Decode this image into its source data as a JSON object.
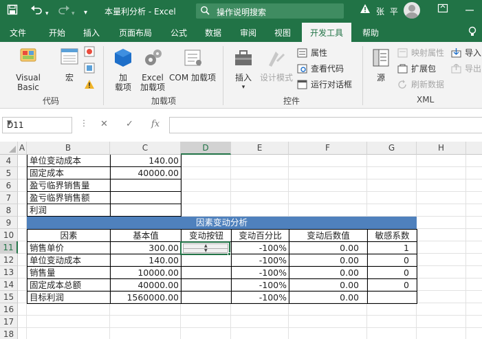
{
  "titlebar": {
    "title": "本量利分析  -  Excel",
    "search_placeholder": "操作说明搜索",
    "user_name": "张 平"
  },
  "tabs": [
    "文件",
    "开始",
    "插入",
    "页面布局",
    "公式",
    "数据",
    "审阅",
    "视图",
    "开发工具",
    "帮助"
  ],
  "active_tab": "开发工具",
  "ribbon": {
    "code_group": {
      "label": "代码",
      "visual_basic": "Visual Basic",
      "macros": "宏"
    },
    "addins_group": {
      "label": "加载项",
      "addins_1": "加",
      "addins_2": "载项",
      "excel_addins_1": "Excel",
      "excel_addins_2": "加载项",
      "com_addins": "COM 加载项"
    },
    "controls_group": {
      "label": "控件",
      "insert": "插入",
      "design_mode": "设计模式",
      "properties": "属性",
      "view_code": "查看代码",
      "run_dialog": "运行对话框"
    },
    "xml_group": {
      "label": "XML",
      "source": "源",
      "map_properties": "映射属性",
      "expansion_packs": "扩展包",
      "refresh_data": "刷新数据",
      "import": "导入",
      "export": "导出"
    }
  },
  "formula_bar": {
    "name_box": "D11",
    "fx": "fx",
    "formula": ""
  },
  "columns": [
    "A",
    "B",
    "C",
    "D",
    "E",
    "F",
    "G",
    "H"
  ],
  "selected_column": "D",
  "rows": [
    "4",
    "5",
    "6",
    "7",
    "8",
    "9",
    "10",
    "11",
    "12",
    "13",
    "14",
    "15",
    "16",
    "17",
    "18"
  ],
  "selected_row": "11",
  "sheet": {
    "top_table": [
      {
        "label": "单位变动成本",
        "value": "140.00"
      },
      {
        "label": "固定成本",
        "value": "40000.00"
      },
      {
        "label": "盈亏临界销售量",
        "value": ""
      },
      {
        "label": "盈亏临界销售额",
        "value": ""
      },
      {
        "label": "利润",
        "value": ""
      }
    ],
    "banner": "因素变动分析",
    "headers": [
      "因素",
      "基本值",
      "变动按钮",
      "变动百分比",
      "变动后数值",
      "敏感系数"
    ],
    "data_rows": [
      {
        "factor": "销售单价",
        "base": "300.00",
        "pct": "-100%",
        "after": "0.00",
        "sens": "1"
      },
      {
        "factor": "单位变动成本",
        "base": "140.00",
        "pct": "-100%",
        "after": "0.00",
        "sens": "0"
      },
      {
        "factor": "销售量",
        "base": "10000.00",
        "pct": "-100%",
        "after": "0.00",
        "sens": "0"
      },
      {
        "factor": "固定成本总额",
        "base": "40000.00",
        "pct": "-100%",
        "after": "0.00",
        "sens": "0"
      },
      {
        "factor": "目标利润",
        "base": "1560000.00",
        "pct": "-100%",
        "after": "0.00",
        "sens": ""
      }
    ]
  },
  "colors": {
    "excel_green": "#217346",
    "banner_blue": "#4f81bd"
  }
}
